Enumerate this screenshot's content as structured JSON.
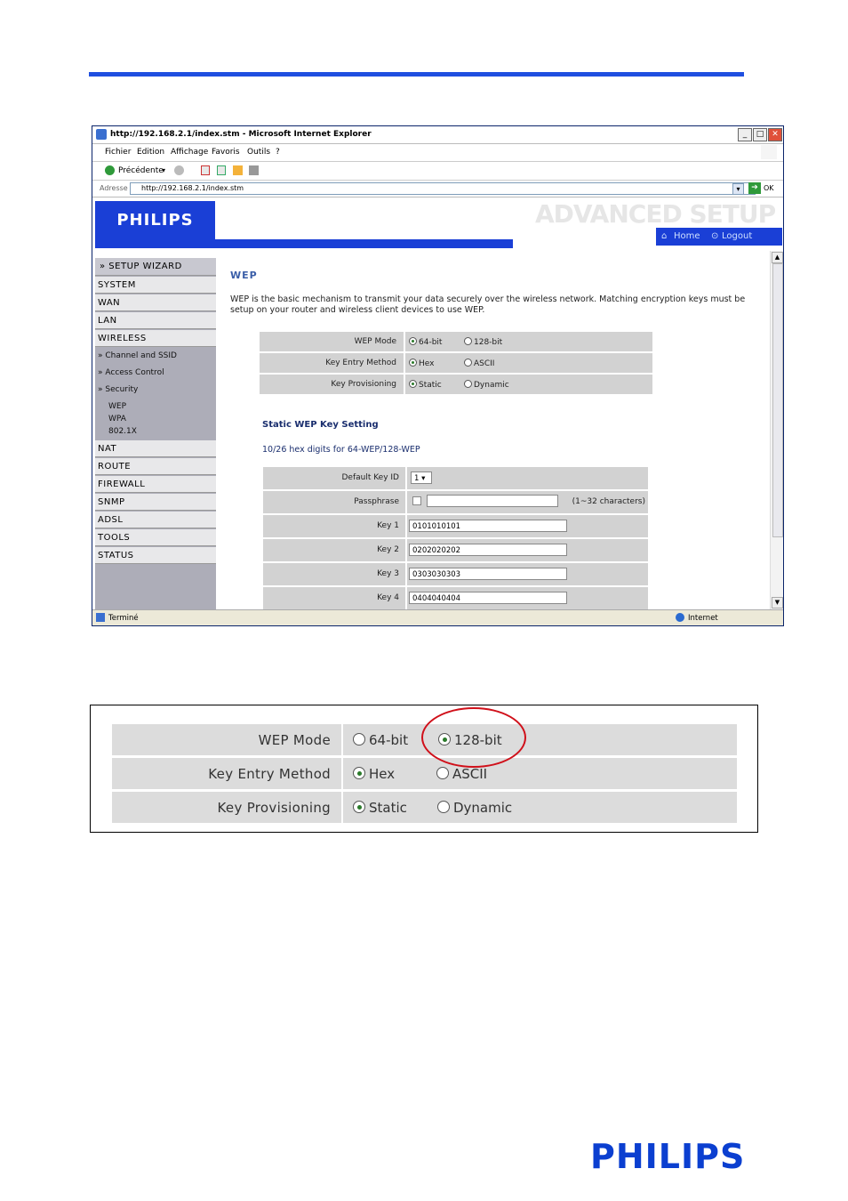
{
  "browser": {
    "title": "http://192.168.2.1/index.stm - Microsoft Internet Explorer",
    "menu": [
      "Fichier",
      "Edition",
      "Affichage",
      "Favoris",
      "Outils",
      "?"
    ],
    "back_label": "Précédente",
    "address_label": "Adresse",
    "address": "http://192.168.2.1/index.stm",
    "go_label": "OK",
    "status_left": "Terminé",
    "status_right": "Internet"
  },
  "router": {
    "brand": "PHILIPS",
    "header": "ADVANCED SETUP",
    "home_link": "Home",
    "logout_link": "Logout",
    "sidebar": {
      "setup_wizard": "» SETUP WIZARD",
      "items_top": [
        "SYSTEM",
        "WAN",
        "LAN",
        "WIRELESS"
      ],
      "wireless_sub": [
        "» Channel and SSID",
        "» Access Control",
        "» Security"
      ],
      "security_sub": [
        "WEP",
        "WPA",
        "802.1X"
      ],
      "items_bottom": [
        "NAT",
        "ROUTE",
        "FIREWALL",
        "SNMP",
        "ADSL",
        "TOOLS",
        "STATUS"
      ]
    },
    "content": {
      "title": "WEP",
      "description": "WEP is the basic mechanism to transmit your data securely over the wireless network. Matching encryption keys must be setup on your router and wireless client devices to use WEP.",
      "wep_mode_label": "WEP Mode",
      "wep_mode_options": [
        "64-bit",
        "128-bit"
      ],
      "wep_mode_selected": "64-bit",
      "key_entry_label": "Key Entry Method",
      "key_entry_options": [
        "Hex",
        "ASCII"
      ],
      "key_entry_selected": "Hex",
      "key_prov_label": "Key Provisioning",
      "key_prov_options": [
        "Static",
        "Dynamic"
      ],
      "key_prov_selected": "Static",
      "static_title": "Static WEP Key Setting",
      "hex_note": "10/26 hex digits for 64-WEP/128-WEP",
      "default_key_label": "Default Key ID",
      "default_key_value": "1",
      "passphrase_label": "Passphrase",
      "passphrase_hint": "(1~32 characters)",
      "keys": [
        {
          "label": "Key 1",
          "value": "0101010101"
        },
        {
          "label": "Key 2",
          "value": "0202020202"
        },
        {
          "label": "Key 3",
          "value": "0303030303"
        },
        {
          "label": "Key 4",
          "value": "0404040404"
        }
      ]
    }
  },
  "zoom": {
    "rows": [
      {
        "label": "WEP Mode",
        "options": [
          "64-bit",
          "128-bit"
        ],
        "selected": "128-bit"
      },
      {
        "label": "Key Entry Method",
        "options": [
          "Hex",
          "ASCII"
        ],
        "selected": "Hex"
      },
      {
        "label": "Key Provisioning",
        "options": [
          "Static",
          "Dynamic"
        ],
        "selected": "Static"
      }
    ],
    "highlight_color": "#d0101a"
  },
  "footer_logo": "PHILIPS",
  "colors": {
    "accent": "#1f4fe0",
    "brand_blue": "#1a3fd6"
  }
}
